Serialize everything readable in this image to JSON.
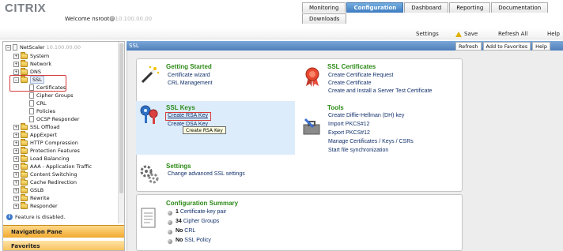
{
  "app": {
    "logo": "CITRIX",
    "welcome": "Welcome nsroot@",
    "welcome_ip": "10.100.00.00"
  },
  "top_tabs": [
    {
      "label": "Monitoring"
    },
    {
      "label": "Configuration"
    },
    {
      "label": "Dashboard"
    },
    {
      "label": "Reporting"
    },
    {
      "label": "Documentation"
    }
  ],
  "downloads_tab": "Downloads",
  "toolbar": {
    "settings": "Settings",
    "save": "Save",
    "refresh_all": "Refresh All",
    "help": "Help"
  },
  "tree": {
    "root": "NetScaler",
    "root_ip": "10.100.00.00",
    "items": [
      "System",
      "Network",
      "DNS",
      "SSL",
      "Certificates",
      "Cipher Groups",
      "CRL",
      "Policies",
      "OCSP Responder",
      "SSL Offload",
      "AppExpert",
      "HTTP Compression",
      "Protection Features",
      "Load Balancing",
      "AAA - Application Traffic",
      "Content Switching",
      "Cache Redirection",
      "GSLB",
      "Rewrite",
      "Responder"
    ],
    "feature_disabled": "Feature is disabled.",
    "nav_pane": "Navigation Pane",
    "favorites": "Favorites"
  },
  "content": {
    "title": "SSL",
    "buttons": {
      "refresh": "Refresh",
      "add_favorites": "Add to Favorites",
      "help": "Help"
    },
    "getting_started": {
      "title": "Getting Started",
      "links": [
        "Certificate wizard",
        "CRL Management"
      ]
    },
    "ssl_certificates": {
      "title": "SSL Certificates",
      "links": [
        "Create Certificate Request",
        "Create Certificate",
        "Create and Install a Server Test Certificate"
      ]
    },
    "ssl_keys": {
      "title": "SSL Keys",
      "links": [
        "Create RSA Key",
        "Create DSA Key"
      ],
      "tooltip": "Create RSA Key"
    },
    "tools": {
      "title": "Tools",
      "links": [
        "Create Diffie-Hellman (DH) key",
        "Import PKCS#12",
        "Export PKCS#12",
        "Manage Certificates / Keys / CSRs",
        "Start file synchronization"
      ]
    },
    "settings": {
      "title": "Settings",
      "links": [
        "Change advanced SSL settings"
      ]
    },
    "summary": {
      "title": "Configuration Summary",
      "rows": [
        {
          "count": "1",
          "label": "Certificate-key pair"
        },
        {
          "count": "34",
          "label": "Cipher Groups"
        },
        {
          "count": "No",
          "label": "CRL"
        },
        {
          "count": "No",
          "label": "SSL Policy"
        }
      ]
    }
  },
  "colors": {
    "accent_blue": "#4f7fba",
    "section_green": "#2c8a17",
    "link_blue": "#13316c",
    "highlight_red": "#d63a3a"
  }
}
